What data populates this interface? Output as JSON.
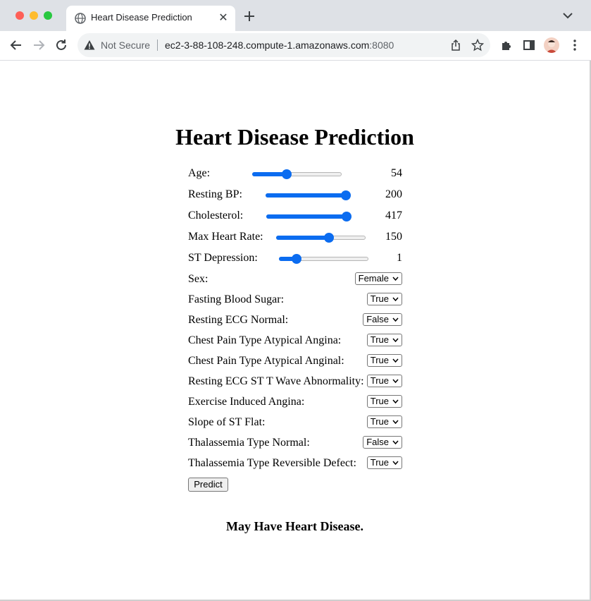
{
  "browser": {
    "tab_title": "Heart Disease Prediction",
    "security_label": "Not Secure",
    "url_host": "ec2-3-88-108-248.compute-1.amazonaws.com",
    "url_port": ":8080"
  },
  "page": {
    "title": "Heart Disease Prediction",
    "sliders": [
      {
        "label": "Age:",
        "value": "54",
        "fraction": 0.37
      },
      {
        "label": "Resting BP:",
        "value": "200",
        "fraction": 1.0
      },
      {
        "label": "Cholesterol:",
        "value": "417",
        "fraction": 1.0
      },
      {
        "label": "Max Heart Rate:",
        "value": "150",
        "fraction": 0.6
      },
      {
        "label": "ST Depression:",
        "value": "1",
        "fraction": 0.16
      }
    ],
    "selects": [
      {
        "label": "Sex:",
        "value": "Female"
      },
      {
        "label": "Fasting Blood Sugar:",
        "value": "True"
      },
      {
        "label": "Resting ECG Normal:",
        "value": "False"
      },
      {
        "label": "Chest Pain Type Atypical Angina:",
        "value": "True"
      },
      {
        "label": "Chest Pain Type Atypical Anginal:",
        "value": "True"
      },
      {
        "label": "Resting ECG ST T Wave Abnormality:",
        "value": "True"
      },
      {
        "label": "Exercise Induced Angina:",
        "value": "True"
      },
      {
        "label": "Slope of ST Flat:",
        "value": "True"
      },
      {
        "label": "Thalassemia Type Normal:",
        "value": "False"
      },
      {
        "label": "Thalassemia Type Reversible Defect:",
        "value": "True"
      }
    ],
    "predict_label": "Predict",
    "result": "May Have Heart Disease."
  },
  "colors": {
    "slider_accent": "#0b6cf0",
    "tabstrip_bg": "#dee1e6"
  }
}
